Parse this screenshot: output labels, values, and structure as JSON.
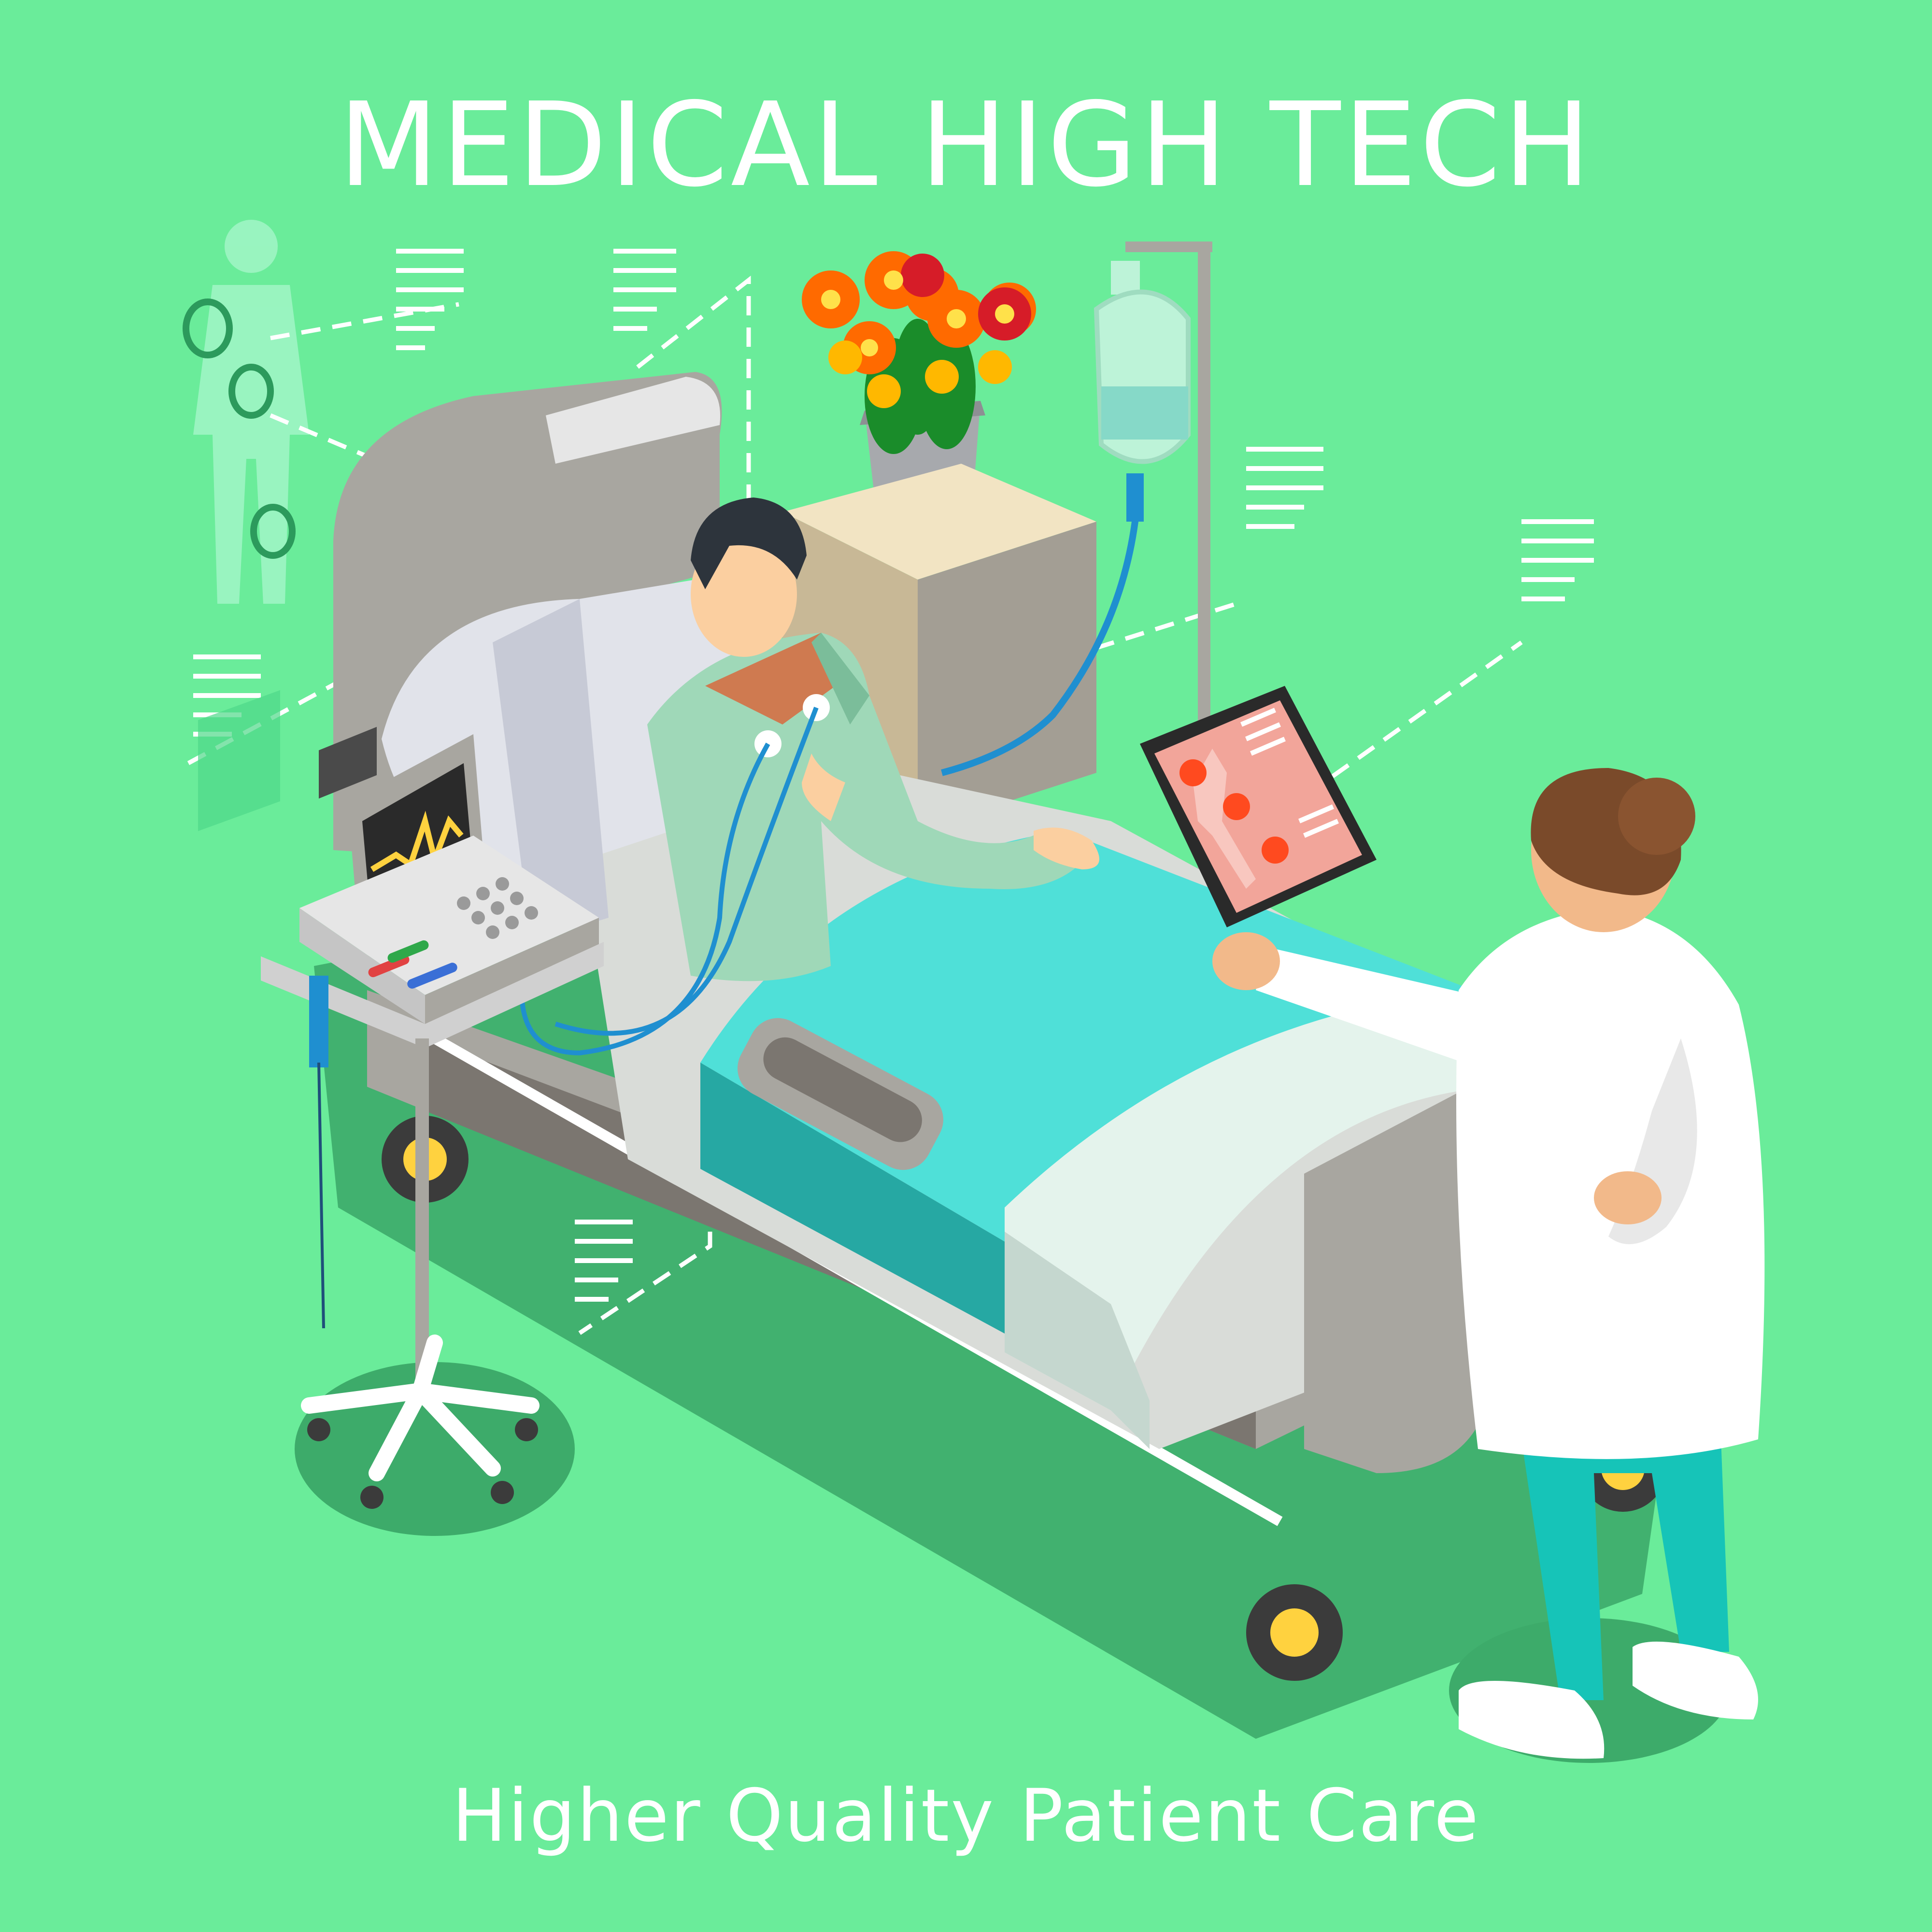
{
  "heading": {
    "title": "MEDICAL HIGH TECH"
  },
  "footer": {
    "subtitle": "Higher Quality Patient Care"
  },
  "colors": {
    "background": "#6aec9a",
    "floor": "#3dab6a",
    "bed_frame": "#a8a6a0",
    "sheet": "#4fe0d8",
    "coat": "#ffffff",
    "scrubs": "#16c4b8",
    "flowers": "#ff6a00",
    "hologram": "#9ff5c4"
  },
  "icons": [
    "body-silhouette-icon",
    "data-lines-icon",
    "heart-monitor-icon",
    "tablet-icon",
    "flower-pot-icon",
    "iv-bag-icon"
  ]
}
